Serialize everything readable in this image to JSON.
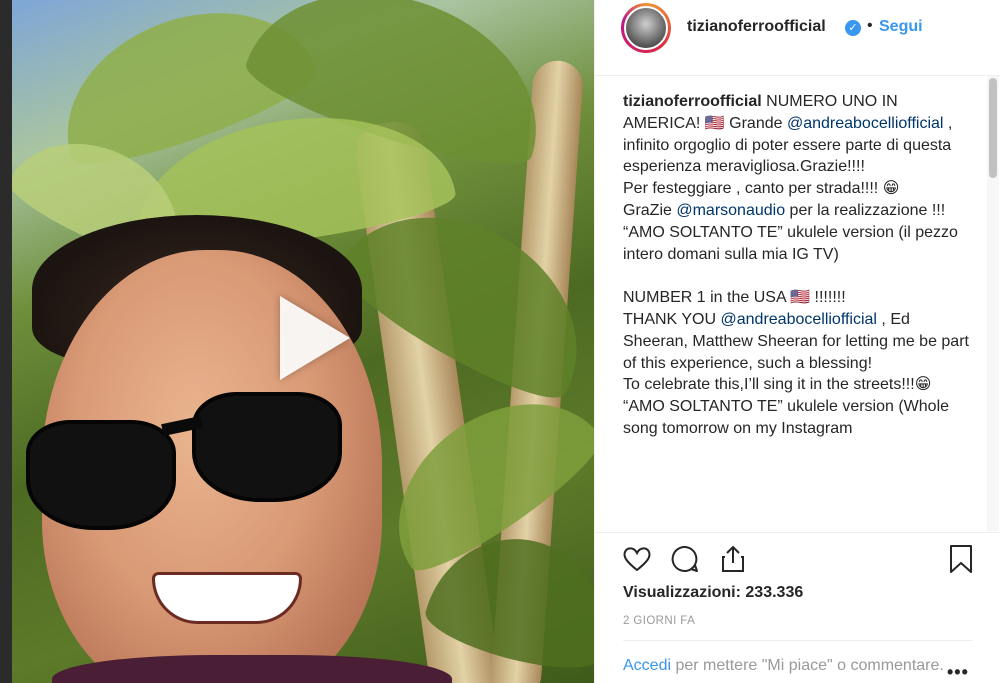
{
  "header": {
    "username": "tizianoferroofficial",
    "verified_mark": "✓",
    "separator": "•",
    "follow_label": "Segui"
  },
  "caption": {
    "username": "tizianoferroofficial",
    "segments": [
      {
        "type": "text",
        "text": " NUMERO UNO IN AMERICA! 🇺🇸 Grande "
      },
      {
        "type": "mention",
        "text": "@andreabocelliofficial"
      },
      {
        "type": "text",
        "text": " , infinito orgoglio di poter essere parte di questa esperienza meravigliosa.Grazie!!!!\nPer festeggiare , canto per strada!!!! 😁\nGraZie "
      },
      {
        "type": "mention",
        "text": "@marsonaudio"
      },
      {
        "type": "text",
        "text": " per la realizzazione !!!\n“AMO SOLTANTO TE” ukulele version (il pezzo intero domani sulla mia IG TV)\n\nNUMBER 1 in the USA 🇺🇸 !!!!!!!\nTHANK YOU "
      },
      {
        "type": "mention",
        "text": "@andreabocelliofficial"
      },
      {
        "type": "text",
        "text": " , Ed Sheeran, Matthew Sheeran for letting me be part of this experience, such a blessing!\nTo celebrate this,I’ll sing it in the streets!!!😁\n“AMO SOLTANTO TE” ukulele version (Whole song tomorrow on my Instagram"
      }
    ]
  },
  "actions": {
    "icons": [
      "heart-icon",
      "comment-icon",
      "share-icon",
      "bookmark-icon"
    ]
  },
  "stats": {
    "views_label": "Visualizzazioni: 233.336",
    "date_label": "2 GIORNI FA"
  },
  "footer": {
    "login_link": "Accedi",
    "login_rest": " per mettere \"Mi piace\" o commentare.",
    "more_label": "•••"
  },
  "colors": {
    "accent": "#3897f0",
    "mention": "#003569",
    "text": "#262626",
    "muted": "#999999"
  }
}
